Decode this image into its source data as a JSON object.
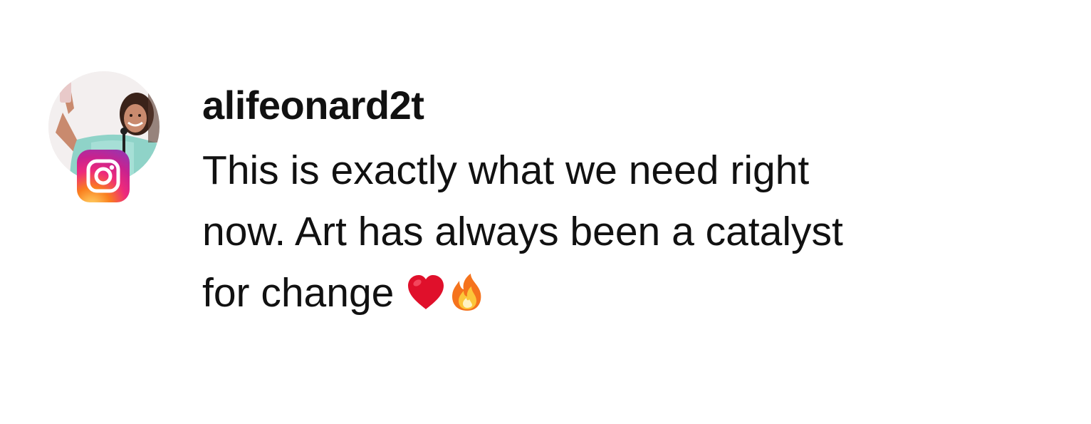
{
  "comment": {
    "username": "alifeonard2t",
    "text_lines": [
      "This is exactly what we need right",
      "now. Art has always been a catalyst",
      "for change"
    ],
    "emojis": [
      "red-heart-icon",
      "fire-icon"
    ]
  },
  "avatar": {
    "badge_icon": "instagram-icon"
  },
  "colors": {
    "text": "#111111",
    "background": "#ffffff",
    "heart": "#e0102b",
    "fire_outer": "#f5731d",
    "fire_inner": "#fcc63a"
  }
}
